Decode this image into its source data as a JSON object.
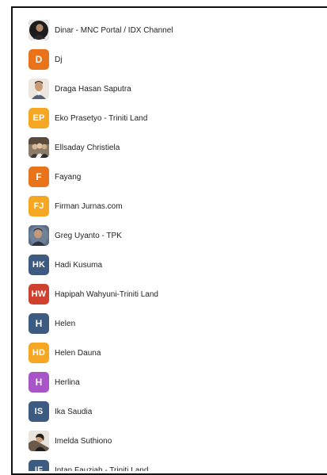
{
  "contacts": [
    {
      "name": "Dinar - MNC Portal / IDX Channel",
      "avatar_type": "photo",
      "avatar_icon": "person-photo-dark-icon",
      "color": "#1f1f1f"
    },
    {
      "name": "Dj",
      "avatar_type": "initials",
      "initials": "D",
      "color": "#e8731a"
    },
    {
      "name": "Draga Hasan Saputra",
      "avatar_type": "photo",
      "avatar_icon": "person-photo-icon",
      "color": "#d9cfc4"
    },
    {
      "name": "Eko Prasetyo - Triniti Land",
      "avatar_type": "initials",
      "initials": "EP",
      "color": "#f5a623"
    },
    {
      "name": "Ellsaday Christiela",
      "avatar_type": "photo",
      "avatar_icon": "group-photo-icon",
      "color": "#7a6a5a"
    },
    {
      "name": "Fayang",
      "avatar_type": "initials",
      "initials": "F",
      "color": "#e8731a"
    },
    {
      "name": "Firman Jurnas.com",
      "avatar_type": "initials",
      "initials": "FJ",
      "color": "#f5a623"
    },
    {
      "name": "Greg Uyanto - TPK",
      "avatar_type": "photo",
      "avatar_icon": "person-photo-icon",
      "color": "#4a5a70"
    },
    {
      "name": "Hadi Kusuma",
      "avatar_type": "initials",
      "initials": "HK",
      "color": "#3d5a80"
    },
    {
      "name": "Hapipah Wahyuni-Triniti Land",
      "avatar_type": "initials",
      "initials": "HW",
      "color": "#d0402f"
    },
    {
      "name": "Helen",
      "avatar_type": "initials",
      "initials": "H",
      "color": "#3d5a80"
    },
    {
      "name": "Helen Dauna",
      "avatar_type": "initials",
      "initials": "HD",
      "color": "#f5a623"
    },
    {
      "name": "Herlina",
      "avatar_type": "initials",
      "initials": "H",
      "color": "#a855c8"
    },
    {
      "name": "Ika Saudia",
      "avatar_type": "initials",
      "initials": "IS",
      "color": "#3d5a80"
    },
    {
      "name": "Imelda Suthiono",
      "avatar_type": "photo",
      "avatar_icon": "person-photo-icon",
      "color": "#8a7a6a"
    },
    {
      "name": "Intan Fauziah - Triniti Land",
      "avatar_type": "initials",
      "initials": "IF",
      "color": "#3d5a80"
    }
  ]
}
